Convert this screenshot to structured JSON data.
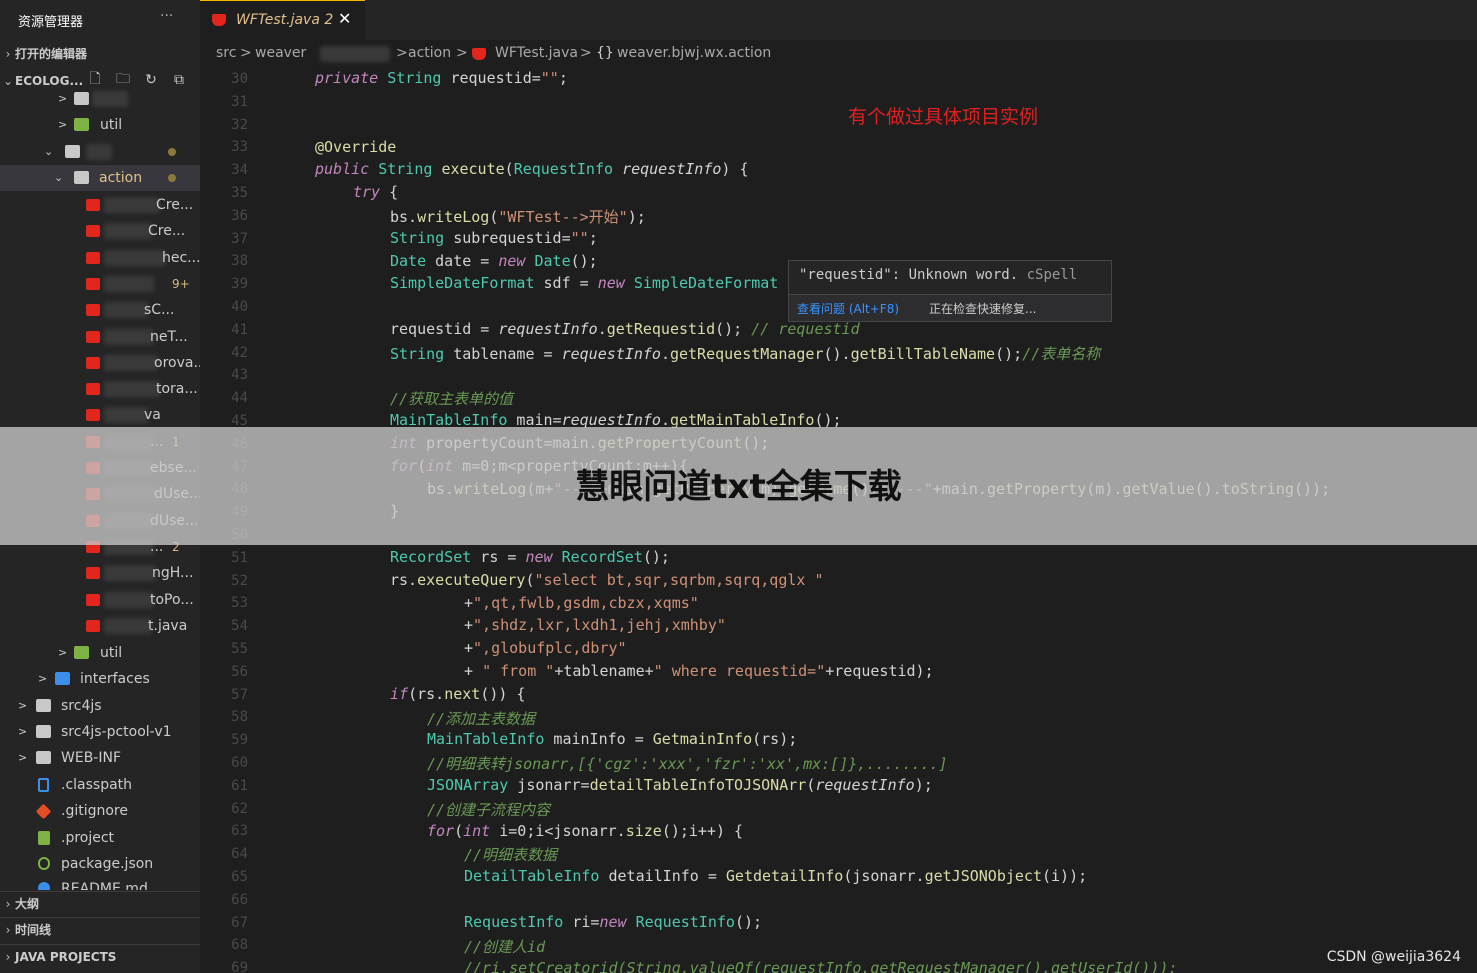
{
  "sidebar": {
    "title": "资源管理器",
    "more": "···",
    "open_editors": "打开的编辑器",
    "project": "ECOLOG...",
    "tree": [
      {
        "label": "",
        "badge": ""
      },
      {
        "label": "util",
        "badge": ""
      },
      {
        "label": "",
        "badge": ""
      },
      {
        "label": "action",
        "badge": ""
      },
      {
        "label": "Cre...",
        "badge": ""
      },
      {
        "label": "Cre...",
        "badge": ""
      },
      {
        "label": "hec...",
        "badge": ""
      },
      {
        "label": "",
        "badge": "9+"
      },
      {
        "label": "sC...",
        "badge": ""
      },
      {
        "label": "neT...",
        "badge": ""
      },
      {
        "label": "orova...",
        "badge": ""
      },
      {
        "label": "tora...",
        "badge": ""
      },
      {
        "label": "va",
        "badge": ""
      },
      {
        "label": "...",
        "badge": "1"
      },
      {
        "label": "ebse...",
        "badge": ""
      },
      {
        "label": "dUse...",
        "badge": ""
      },
      {
        "label": "dUse...",
        "badge": ""
      },
      {
        "label": "...",
        "badge": "2"
      },
      {
        "label": "ngH...",
        "badge": ""
      },
      {
        "label": "toPo...",
        "badge": ""
      },
      {
        "label": "t.java",
        "badge": ""
      },
      {
        "label": "util",
        "badge": ""
      },
      {
        "label": "interfaces",
        "badge": ""
      },
      {
        "label": "src4js",
        "badge": ""
      },
      {
        "label": "src4js-pctool-v1",
        "badge": ""
      },
      {
        "label": "WEB-INF",
        "badge": ""
      },
      {
        "label": ".classpath",
        "badge": ""
      },
      {
        "label": ".gitignore",
        "badge": ""
      },
      {
        "label": ".project",
        "badge": ""
      },
      {
        "label": "package.json",
        "badge": ""
      },
      {
        "label": "README.md",
        "badge": ""
      }
    ],
    "outline": "大纲",
    "timeline": "时间线",
    "java_projects": "JAVA PROJECTS"
  },
  "tab": {
    "label": "WFTest.java 2",
    "close": "✕"
  },
  "breadcrumb": {
    "src": "src",
    "weaver": "weaver",
    "action": "action",
    "file": "WFTest.java",
    "symbol_icon": "{}",
    "symbol": "weaver.bjwj.wx.action",
    "sep": ">"
  },
  "editor": {
    "line_numbers": [
      "30",
      "31",
      "32",
      "33",
      "34",
      "35",
      "36",
      "37",
      "38",
      "39",
      "40",
      "41",
      "42",
      "43",
      "44",
      "45",
      "46",
      "47",
      "48",
      "49",
      "50",
      "51",
      "52",
      "53",
      "54",
      "55",
      "56",
      "57",
      "58",
      "59",
      "60",
      "61",
      "62",
      "63",
      "64",
      "65",
      "66",
      "67",
      "68",
      "69"
    ],
    "annotation": "有个做过具体项目实例"
  },
  "hover": {
    "message": "\"requestid\": Unknown word.",
    "source": "cSpell",
    "action_view": "查看问题 (Alt+F8)",
    "action_fix": "正在检查快速修复..."
  },
  "overlay": {
    "title": "慧眼问道txt全集下载"
  },
  "watermark": "CSDN @weijia3624",
  "colors": {
    "bg": "#1e1e1e",
    "sidebar": "#252526",
    "accent": "#f2b500",
    "annotation": "#e02020"
  }
}
